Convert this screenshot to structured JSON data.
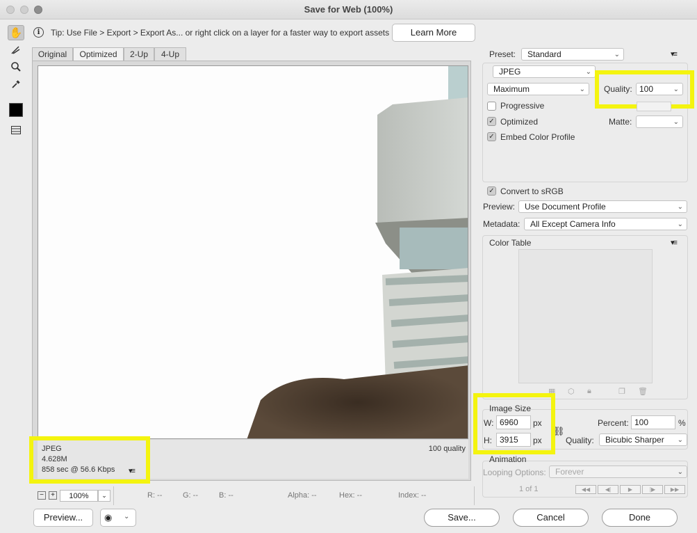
{
  "window": {
    "title": "Save for Web (100%)"
  },
  "tip": {
    "text": "Tip: Use File > Export > Export As...  or right click on a layer for a faster way to export assets",
    "learn_more": "Learn More"
  },
  "tabs": [
    "Original",
    "Optimized",
    "2-Up",
    "4-Up"
  ],
  "tools": [
    "hand-icon",
    "slice-select-icon",
    "zoom-icon",
    "eyedropper-icon",
    "eyedropper-color-swatch",
    "toggle-slices-icon"
  ],
  "preview_info": {
    "format": "JPEG",
    "size": "4.628M",
    "time": "858 sec @ 56.6 Kbps",
    "quality_label": "100 quality"
  },
  "status_bar": {
    "zoom": "100%",
    "r": "R: --",
    "g": "G: --",
    "b": "B: --",
    "alpha": "Alpha: --",
    "hex": "Hex: --",
    "index": "Index: --"
  },
  "settings": {
    "preset_label": "Preset:",
    "preset_value": "Standard",
    "format_value": "JPEG",
    "compression_value": "Maximum",
    "quality_label": "Quality:",
    "quality_value": "100",
    "progressive_label": "Progressive",
    "progressive_checked": false,
    "optimized_label": "Optimized",
    "optimized_checked": true,
    "embed_label": "Embed Color Profile",
    "embed_checked": true,
    "matte_label": "Matte:",
    "convert_label": "Convert to sRGB",
    "convert_checked": true,
    "preview_label": "Preview:",
    "preview_value": "Use Document Profile",
    "metadata_label": "Metadata:",
    "metadata_value": "All Except Camera Info"
  },
  "color_table": {
    "title": "Color Table"
  },
  "image_size": {
    "title": "Image Size",
    "w_label": "W:",
    "w_value": "6960",
    "h_label": "H:",
    "h_value": "3915",
    "unit": "px",
    "percent_label": "Percent:",
    "percent_value": "100",
    "percent_unit": "%",
    "quality_label": "Quality:",
    "quality_value": "Bicubic Sharper"
  },
  "animation": {
    "title": "Animation",
    "looping_label": "Looping Options:",
    "looping_value": "Forever",
    "frame_counter": "1 of 1"
  },
  "buttons": {
    "preview": "Preview...",
    "save": "Save...",
    "cancel": "Cancel",
    "done": "Done"
  },
  "colors": {
    "highlight": "#f4f40f"
  }
}
